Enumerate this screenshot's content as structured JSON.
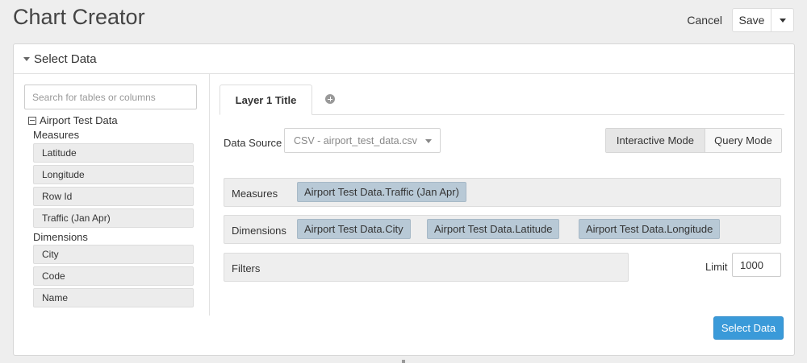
{
  "app": {
    "title": "Chart Creator"
  },
  "top_actions": {
    "cancel_label": "Cancel",
    "save_label": "Save"
  },
  "panel": {
    "header_label": "Select Data"
  },
  "sidebar": {
    "search_placeholder": "Search for tables or columns",
    "table_name": "Airport Test Data",
    "measures_label": "Measures",
    "measures": [
      "Latitude",
      "Longitude",
      "Row Id",
      "Traffic (Jan Apr)"
    ],
    "dimensions_label": "Dimensions",
    "dimensions": [
      "City",
      "Code",
      "Name"
    ]
  },
  "layer": {
    "tab_label": "Layer 1 Title"
  },
  "data_source": {
    "label": "Data Source",
    "selected": "CSV - airport_test_data.csv"
  },
  "modes": {
    "interactive": "Interactive Mode",
    "query": "Query Mode",
    "active": "interactive"
  },
  "measures_row": {
    "label": "Measures",
    "chips": [
      "Airport Test Data.Traffic (Jan Apr)"
    ]
  },
  "dimensions_row": {
    "label": "Dimensions",
    "chips": [
      "Airport Test Data.City",
      "Airport Test Data.Latitude",
      "Airport Test Data.Longitude"
    ]
  },
  "filters_row": {
    "label": "Filters"
  },
  "limit": {
    "label": "Limit",
    "value": "1000"
  },
  "select_data_button": {
    "label": "Select Data"
  },
  "colors": {
    "accent": "#3a9ad9",
    "chip": "#b8c9d6",
    "background": "#eeeeee"
  },
  "icons": {
    "add_tab": "plus-circle-icon",
    "tree_toggle": "minus-square-icon",
    "caret": "caret-down-icon"
  }
}
